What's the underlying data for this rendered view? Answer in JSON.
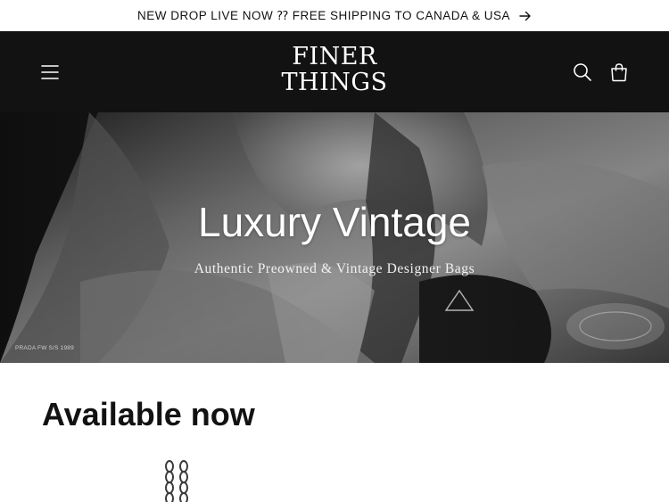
{
  "announcement": {
    "text": "NEW DROP LIVE NOW ⁇ FREE SHIPPING TO CANADA & USA",
    "arrow_icon": "arrow-right-icon"
  },
  "header": {
    "logo_line1": "FINER",
    "logo_line2": "THINGS",
    "menu_icon": "hamburger-menu-icon",
    "search_icon": "search-icon",
    "cart_icon": "cart-icon",
    "background": "#121212"
  },
  "hero": {
    "title": "Luxury Vintage",
    "subtitle": "Authentic Preowned & Vintage Designer Bags",
    "caption": "PRADA FW S/S 1989",
    "badge_text": "PRADA"
  },
  "collection": {
    "title": "Available now",
    "product_icon": "chain-strap-icon"
  }
}
